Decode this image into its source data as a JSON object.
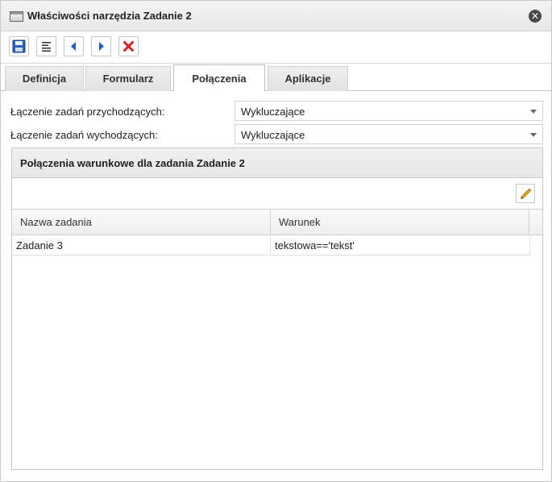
{
  "window": {
    "title": "Właściwości narzędzia Zadanie 2"
  },
  "toolbar": {
    "buttons": [
      {
        "icon": "save-icon"
      },
      {
        "icon": "align-icon"
      },
      {
        "icon": "arrow-left-icon"
      },
      {
        "icon": "arrow-right-icon"
      },
      {
        "icon": "delete-icon"
      }
    ]
  },
  "tabs": [
    {
      "label": "Definicja"
    },
    {
      "label": "Formularz"
    },
    {
      "label": "Połączenia",
      "active": true
    },
    {
      "label": "Aplikacje"
    }
  ],
  "form": {
    "incoming_label": "Łączenie zadań przychodzących:",
    "incoming_value": "Wykluczające",
    "outgoing_label": "Łączenie zadań wychodzących:",
    "outgoing_value": "Wykluczające"
  },
  "panel": {
    "title": "Połączenia warunkowe dla zadania Zadanie 2",
    "columns": [
      "Nazwa zadania",
      "Warunek"
    ],
    "rows": [
      {
        "task": "Zadanie 3",
        "condition": "tekstowa=='tekst'"
      }
    ]
  },
  "colors": {
    "accent_blue": "#1f5fbf",
    "delete_red": "#d42020",
    "pencil_yellow": "#e8b21a"
  }
}
